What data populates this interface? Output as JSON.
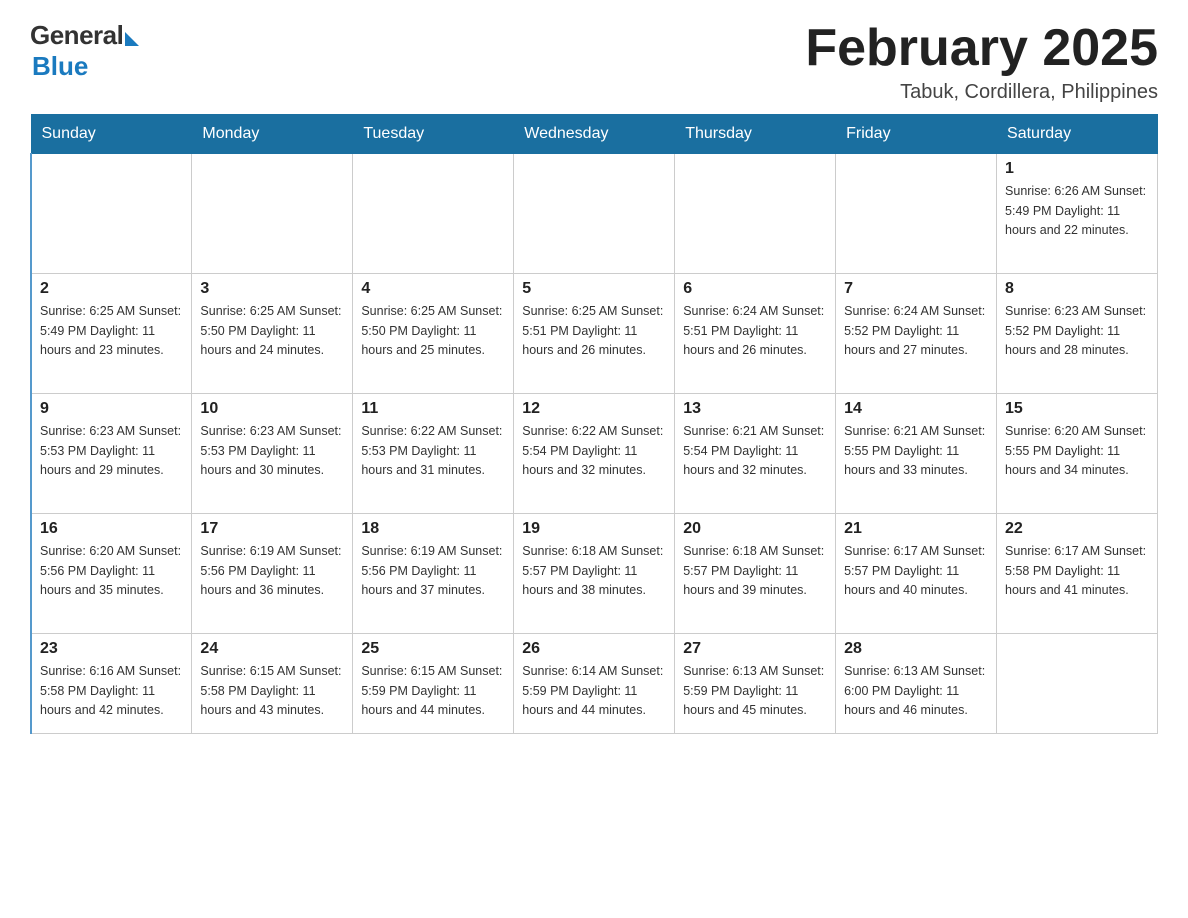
{
  "header": {
    "logo_general": "General",
    "logo_blue": "Blue",
    "month_title": "February 2025",
    "location": "Tabuk, Cordillera, Philippines"
  },
  "days_of_week": [
    "Sunday",
    "Monday",
    "Tuesday",
    "Wednesday",
    "Thursday",
    "Friday",
    "Saturday"
  ],
  "weeks": [
    [
      {
        "day": "",
        "info": ""
      },
      {
        "day": "",
        "info": ""
      },
      {
        "day": "",
        "info": ""
      },
      {
        "day": "",
        "info": ""
      },
      {
        "day": "",
        "info": ""
      },
      {
        "day": "",
        "info": ""
      },
      {
        "day": "1",
        "info": "Sunrise: 6:26 AM\nSunset: 5:49 PM\nDaylight: 11 hours\nand 22 minutes."
      }
    ],
    [
      {
        "day": "2",
        "info": "Sunrise: 6:25 AM\nSunset: 5:49 PM\nDaylight: 11 hours\nand 23 minutes."
      },
      {
        "day": "3",
        "info": "Sunrise: 6:25 AM\nSunset: 5:50 PM\nDaylight: 11 hours\nand 24 minutes."
      },
      {
        "day": "4",
        "info": "Sunrise: 6:25 AM\nSunset: 5:50 PM\nDaylight: 11 hours\nand 25 minutes."
      },
      {
        "day": "5",
        "info": "Sunrise: 6:25 AM\nSunset: 5:51 PM\nDaylight: 11 hours\nand 26 minutes."
      },
      {
        "day": "6",
        "info": "Sunrise: 6:24 AM\nSunset: 5:51 PM\nDaylight: 11 hours\nand 26 minutes."
      },
      {
        "day": "7",
        "info": "Sunrise: 6:24 AM\nSunset: 5:52 PM\nDaylight: 11 hours\nand 27 minutes."
      },
      {
        "day": "8",
        "info": "Sunrise: 6:23 AM\nSunset: 5:52 PM\nDaylight: 11 hours\nand 28 minutes."
      }
    ],
    [
      {
        "day": "9",
        "info": "Sunrise: 6:23 AM\nSunset: 5:53 PM\nDaylight: 11 hours\nand 29 minutes."
      },
      {
        "day": "10",
        "info": "Sunrise: 6:23 AM\nSunset: 5:53 PM\nDaylight: 11 hours\nand 30 minutes."
      },
      {
        "day": "11",
        "info": "Sunrise: 6:22 AM\nSunset: 5:53 PM\nDaylight: 11 hours\nand 31 minutes."
      },
      {
        "day": "12",
        "info": "Sunrise: 6:22 AM\nSunset: 5:54 PM\nDaylight: 11 hours\nand 32 minutes."
      },
      {
        "day": "13",
        "info": "Sunrise: 6:21 AM\nSunset: 5:54 PM\nDaylight: 11 hours\nand 32 minutes."
      },
      {
        "day": "14",
        "info": "Sunrise: 6:21 AM\nSunset: 5:55 PM\nDaylight: 11 hours\nand 33 minutes."
      },
      {
        "day": "15",
        "info": "Sunrise: 6:20 AM\nSunset: 5:55 PM\nDaylight: 11 hours\nand 34 minutes."
      }
    ],
    [
      {
        "day": "16",
        "info": "Sunrise: 6:20 AM\nSunset: 5:56 PM\nDaylight: 11 hours\nand 35 minutes."
      },
      {
        "day": "17",
        "info": "Sunrise: 6:19 AM\nSunset: 5:56 PM\nDaylight: 11 hours\nand 36 minutes."
      },
      {
        "day": "18",
        "info": "Sunrise: 6:19 AM\nSunset: 5:56 PM\nDaylight: 11 hours\nand 37 minutes."
      },
      {
        "day": "19",
        "info": "Sunrise: 6:18 AM\nSunset: 5:57 PM\nDaylight: 11 hours\nand 38 minutes."
      },
      {
        "day": "20",
        "info": "Sunrise: 6:18 AM\nSunset: 5:57 PM\nDaylight: 11 hours\nand 39 minutes."
      },
      {
        "day": "21",
        "info": "Sunrise: 6:17 AM\nSunset: 5:57 PM\nDaylight: 11 hours\nand 40 minutes."
      },
      {
        "day": "22",
        "info": "Sunrise: 6:17 AM\nSunset: 5:58 PM\nDaylight: 11 hours\nand 41 minutes."
      }
    ],
    [
      {
        "day": "23",
        "info": "Sunrise: 6:16 AM\nSunset: 5:58 PM\nDaylight: 11 hours\nand 42 minutes."
      },
      {
        "day": "24",
        "info": "Sunrise: 6:15 AM\nSunset: 5:58 PM\nDaylight: 11 hours\nand 43 minutes."
      },
      {
        "day": "25",
        "info": "Sunrise: 6:15 AM\nSunset: 5:59 PM\nDaylight: 11 hours\nand 44 minutes."
      },
      {
        "day": "26",
        "info": "Sunrise: 6:14 AM\nSunset: 5:59 PM\nDaylight: 11 hours\nand 44 minutes."
      },
      {
        "day": "27",
        "info": "Sunrise: 6:13 AM\nSunset: 5:59 PM\nDaylight: 11 hours\nand 45 minutes."
      },
      {
        "day": "28",
        "info": "Sunrise: 6:13 AM\nSunset: 6:00 PM\nDaylight: 11 hours\nand 46 minutes."
      },
      {
        "day": "",
        "info": ""
      }
    ]
  ]
}
